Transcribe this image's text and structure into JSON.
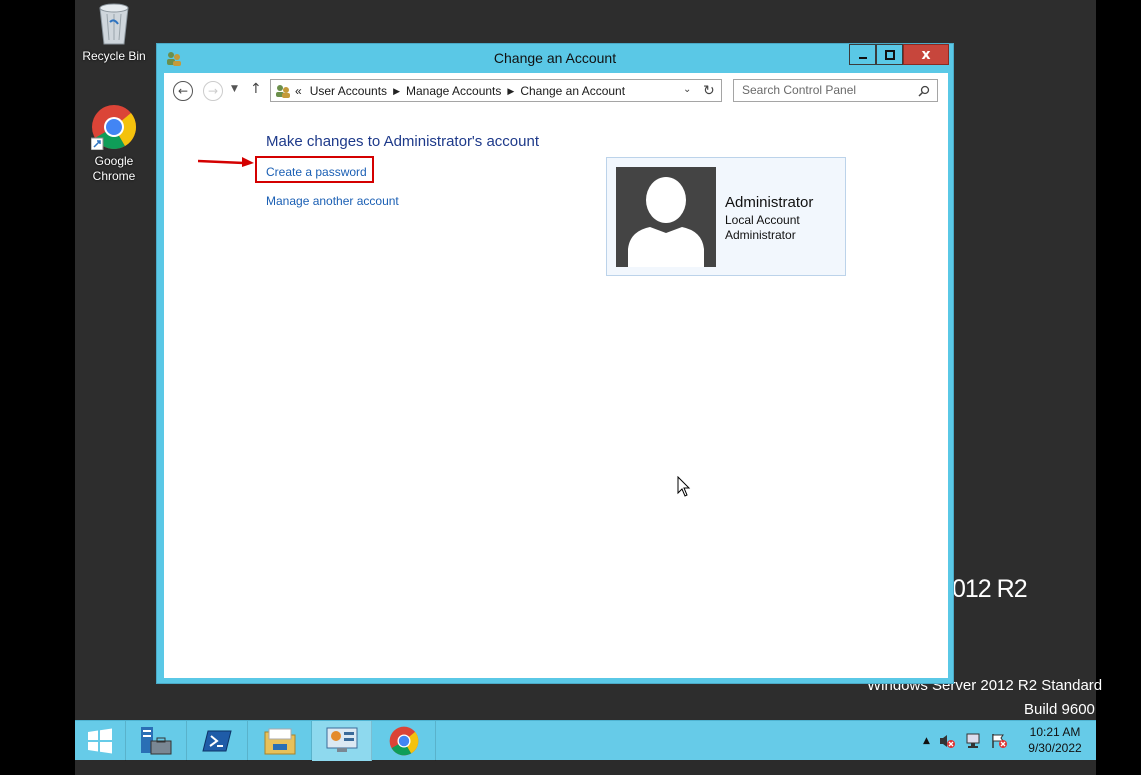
{
  "desktop": {
    "icons": [
      {
        "label": "Recycle Bin",
        "icon": "recycle-bin-icon"
      },
      {
        "label": "Google Chrome",
        "icon": "chrome-icon"
      }
    ],
    "watermark_partial": "012 R2",
    "watermark_line1": "Windows Server 2012 R2 Standard",
    "watermark_line2": "Build 9600"
  },
  "window": {
    "title": "Change an Account",
    "close_label": "x",
    "breadcrumb": {
      "overflow": "«",
      "items": [
        "User Accounts",
        "Manage Accounts",
        "Change an Account"
      ]
    },
    "search": {
      "placeholder": "Search Control Panel"
    },
    "content": {
      "heading": "Make changes to Administrator's account",
      "links": [
        "Create a password",
        "Manage another account"
      ],
      "account": {
        "name": "Administrator",
        "type": "Local Account",
        "role": "Administrator"
      }
    }
  },
  "taskbar": {
    "buttons": [
      "start-icon",
      "server-manager-icon",
      "powershell-icon",
      "file-explorer-icon",
      "control-panel-icon",
      "chrome-icon"
    ],
    "clock": {
      "time": "10:21 AM",
      "date": "9/30/2022"
    }
  },
  "colors": {
    "window_frame": "#5ac8e6",
    "taskbar": "#66cbe8",
    "link": "#1a5fb4",
    "heading": "#1e3a8a",
    "highlight": "#d40000"
  }
}
